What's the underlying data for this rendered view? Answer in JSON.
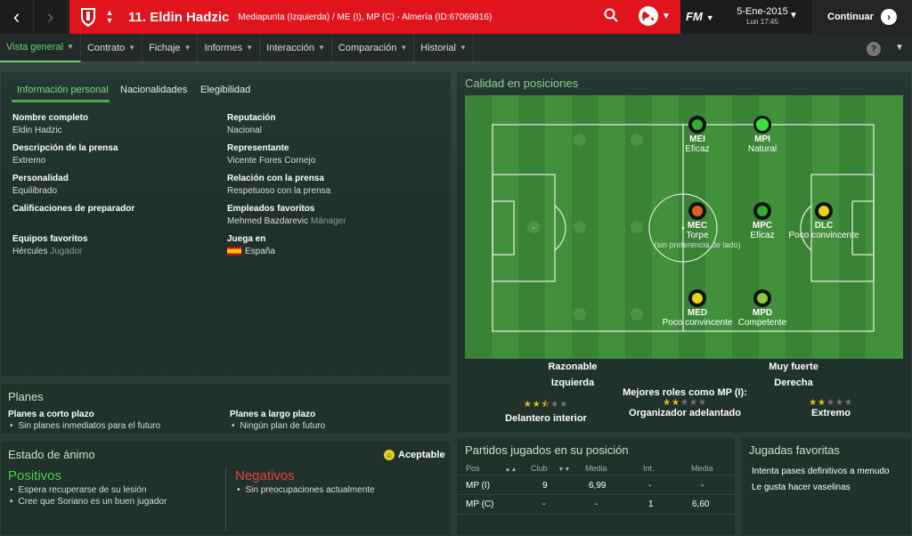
{
  "topbar": {
    "back_label": "‹",
    "forward_label": "›",
    "player_title": "11. Eldin Hadzic",
    "player_desc": "Mediapunta (Izquierda) / ME (I), MP (C) - Almería (ID:67069816)",
    "fm_logo": "FM",
    "date": "5-Ene-2015",
    "day_time": "Lun 17:45",
    "continue_label": "Continuar"
  },
  "nav": {
    "tabs": [
      "Vista general",
      "Contrato",
      "Fichaje",
      "Informes",
      "Interacción",
      "Comparación",
      "Historial"
    ],
    "help_label": "?"
  },
  "info": {
    "subtabs": [
      "Información personal",
      "Nacionalidades",
      "Elegibilidad"
    ],
    "fields": [
      {
        "label": "Nombre completo",
        "value": "Eldin Hadzic",
        "sub": ""
      },
      {
        "label": "Reputación",
        "value": "Nacional",
        "sub": ""
      },
      {
        "label": "Descripción de la prensa",
        "value": "Extremo",
        "sub": ""
      },
      {
        "label": "Representante",
        "value": "Vicente Fores Cornejo",
        "sub": ""
      },
      {
        "label": "Personalidad",
        "value": "Equilibrado",
        "sub": ""
      },
      {
        "label": "Relación con la prensa",
        "value": "Respetuoso con la prensa",
        "sub": ""
      },
      {
        "label": "Calificaciones de preparador",
        "value": "",
        "sub": ""
      },
      {
        "label": "Empleados favoritos",
        "value": "Mehmed Bazdarevic",
        "sub": "Mánager"
      },
      {
        "label": "Equipos favoritos",
        "value": "Hércules",
        "sub": "Jugador"
      },
      {
        "label": "Juega en",
        "value": "España",
        "sub": ""
      }
    ]
  },
  "planes": {
    "title": "Planes",
    "short_label": "Planes a corto plazo",
    "short_item": "Sin planes inmediatos para el futuro",
    "long_label": "Planes a largo plazo",
    "long_item": "Ningún plan de futuro"
  },
  "animo": {
    "title": "Estado de ánimo",
    "status": "Aceptable",
    "pos_title": "Positivos",
    "pos_items": [
      "Espera recuperarse de su lesión",
      "Cree que Soriano es un buen jugador"
    ],
    "neg_title": "Negativos",
    "neg_items": [
      "Sin preocupaciones actualmente"
    ]
  },
  "calidad": {
    "title": "Calidad en posiciones",
    "roles": [
      {
        "code": "MEI",
        "rating": "Eficaz",
        "note": "",
        "color": "#2fae2f"
      },
      {
        "code": "MPI",
        "rating": "Natural",
        "note": "",
        "color": "#3be03b"
      },
      {
        "code": "MEC",
        "rating": "Torpe",
        "note": "(sin preferencia de lado)",
        "color": "#e0601a"
      },
      {
        "code": "MPC",
        "rating": "Eficaz",
        "note": "",
        "color": "#2fae2f"
      },
      {
        "code": "DLC",
        "rating": "Poco convincente",
        "note": "",
        "color": "#e6d21a"
      },
      {
        "code": "MED",
        "rating": "Poco convincente",
        "note": "",
        "color": "#e6d21a"
      },
      {
        "code": "MPD",
        "rating": "Competente",
        "note": "",
        "color": "#8cc83a"
      }
    ],
    "foot_left_label": "Razonable",
    "foot_left_side": "Izquierda",
    "foot_right_label": "Muy fuerte",
    "foot_right_side": "Derecha",
    "best_roles_title": "Mejores roles como MP (I):",
    "best_roles": [
      {
        "name": "Delantero interior",
        "stars": 2.5
      },
      {
        "name": "Organizador adelantado",
        "stars": 2
      },
      {
        "name": "Extremo",
        "stars": 2
      }
    ]
  },
  "partidos": {
    "title": "Partidos jugados en su posición",
    "headers": [
      "Pos",
      "Club",
      "Media",
      "Int.",
      "Media"
    ],
    "rows": [
      [
        "MP (I)",
        "9",
        "6,99",
        "-",
        "-"
      ],
      [
        "MP (C)",
        "-",
        "-",
        "1",
        "6,60"
      ]
    ]
  },
  "jugadas": {
    "title": "Jugadas favoritas",
    "items": [
      "Intenta pases definitivos a menudo",
      "Le gusta hacer vaselinas"
    ]
  },
  "colors": {
    "accent_red": "#e0141c",
    "accent_green": "#6bd36b"
  }
}
